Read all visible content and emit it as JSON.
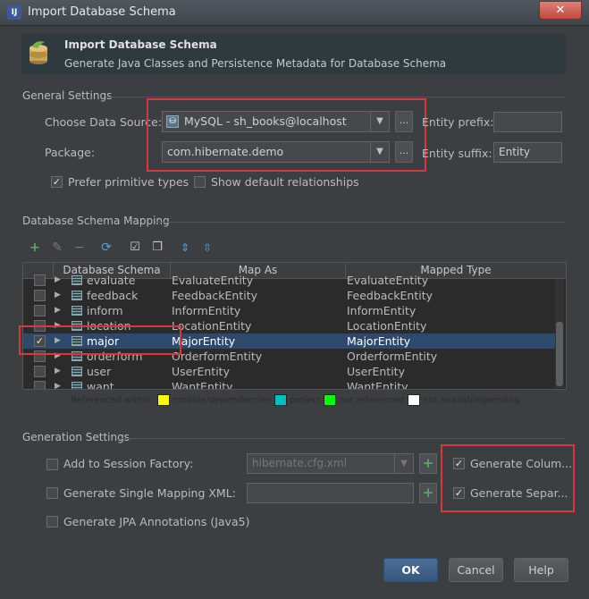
{
  "window": {
    "title": "Import Database Schema",
    "close_glyph": "✕"
  },
  "header": {
    "title": "Import Database Schema",
    "subtitle": "Generate Java Classes and Persistence Metadata for Database Schema"
  },
  "general": {
    "section": "General Settings",
    "data_source_label": "Choose Data Source:",
    "data_source_value": "MySQL - sh_books@localhost",
    "package_label": "Package:",
    "package_value": "com.hibernate.demo",
    "entity_prefix_label": "Entity prefix:",
    "entity_prefix_value": "",
    "entity_suffix_label": "Entity suffix:",
    "entity_suffix_value": "Entity",
    "prefer_primitive": {
      "label": "Prefer primitive types",
      "checked": true
    },
    "show_default_rel": {
      "label": "Show default relationships",
      "checked": false
    },
    "browse_glyph": "..."
  },
  "mapping": {
    "section": "Database Schema Mapping",
    "columns": [
      "Database Schema",
      "Map As",
      "Mapped Type"
    ],
    "rows": [
      {
        "checked": false,
        "schema": "evaluate",
        "map_as": "EvaluateEntity",
        "type": "EvaluateEntity",
        "selected": false
      },
      {
        "checked": false,
        "schema": "feedback",
        "map_as": "FeedbackEntity",
        "type": "FeedbackEntity",
        "selected": false
      },
      {
        "checked": false,
        "schema": "inform",
        "map_as": "InformEntity",
        "type": "InformEntity",
        "selected": false
      },
      {
        "checked": false,
        "schema": "location",
        "map_as": "LocationEntity",
        "type": "LocationEntity",
        "selected": false
      },
      {
        "checked": true,
        "schema": "major",
        "map_as": "MajorEntity",
        "type": "MajorEntity",
        "selected": true
      },
      {
        "checked": false,
        "schema": "orderform",
        "map_as": "OrderformEntity",
        "type": "OrderformEntity",
        "selected": false
      },
      {
        "checked": false,
        "schema": "user",
        "map_as": "UserEntity",
        "type": "UserEntity",
        "selected": false
      },
      {
        "checked": false,
        "schema": "want",
        "map_as": "WantEntity",
        "type": "WantEntity",
        "selected": false
      }
    ],
    "legend": {
      "prefix": "Referenced within:",
      "items": [
        {
          "label": "module/dependencies",
          "color": "#ffff00"
        },
        {
          "label": "project",
          "color": "#00bfbf"
        },
        {
          "label": "not referenced",
          "color": "#00ff00"
        },
        {
          "label": "not available/pending",
          "color": "#ffffff"
        }
      ]
    }
  },
  "generation": {
    "section": "Generation Settings",
    "add_session": {
      "label": "Add to Session Factory:",
      "checked": false,
      "value": "hibernate.cfg.xml"
    },
    "single_xml": {
      "label": "Generate Single Mapping XML:",
      "checked": false,
      "value": ""
    },
    "jpa": {
      "label": "Generate JPA Annotations (Java5)",
      "checked": false
    },
    "gen_column": {
      "label": "Generate Colum...",
      "checked": true
    },
    "gen_separate": {
      "label": "Generate Separ...",
      "checked": true
    },
    "plus_glyph": "+"
  },
  "buttons": {
    "ok": "OK",
    "cancel": "Cancel",
    "help": "Help"
  },
  "colors": {
    "accent_red": "#d9363e",
    "selection": "#2d4a6d",
    "primary_button": "#3e6189"
  }
}
